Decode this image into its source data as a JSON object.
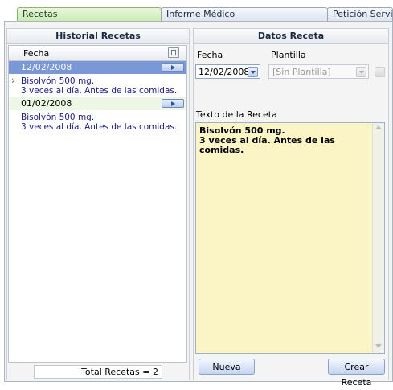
{
  "tabs": [
    "Recetas",
    "Informe Médico",
    "Petición Servicio"
  ],
  "historial": {
    "title": "Historial Recetas",
    "column_header": "Fecha",
    "rows": [
      {
        "date": "12/02/2008",
        "text_lines": [
          "Bisolvón 500 mg.",
          "3 veces al día. Antes de las comidas."
        ]
      },
      {
        "date": "01/02/2008",
        "text_lines": [
          "Bisolvón 500 mg.",
          "3 veces al día. Antes de las comidas."
        ]
      }
    ],
    "total": "Total Recetas = 2"
  },
  "datos": {
    "title": "Datos Receta",
    "fecha_label": "Fecha",
    "fecha_value": "12/02/2008",
    "plantilla_label": "Plantilla",
    "plantilla_value": "[Sin Plantilla]",
    "texto_label": "Texto de la Receta",
    "texto_lines": [
      "Bisolvón 500 mg.",
      "3 veces al día. Antes de las comidas."
    ],
    "nueva_label": "Nueva",
    "crear_label": "Crear Receta"
  },
  "colors": {
    "active_tab": "#c9ecb1",
    "selected_row": "#7a98d6",
    "textarea_bg": "#fbf4c4"
  }
}
